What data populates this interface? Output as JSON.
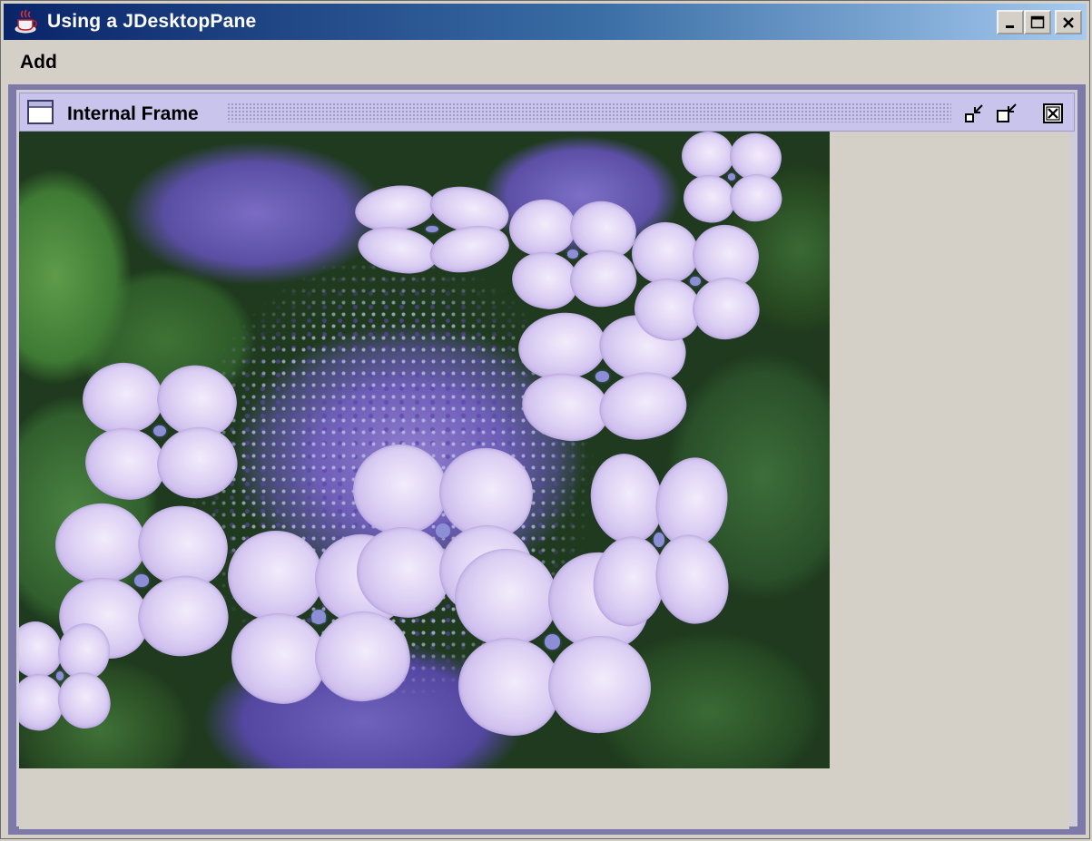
{
  "window": {
    "title": "Using a JDesktopPane",
    "controls": [
      "minimize-icon",
      "maximize-icon",
      "close-icon"
    ]
  },
  "menubar": {
    "items": [
      {
        "label": "Add"
      }
    ]
  },
  "internal_frame": {
    "title": "Internal Frame",
    "controls": [
      "iconify-icon",
      "maximize-icon",
      "close-icon"
    ],
    "content": "hydrangea-photo"
  },
  "colors": {
    "titlebar_start": "#0a246a",
    "titlebar_end": "#a6caf0",
    "internal_frame_border": "#7d79a8",
    "internal_titlebar": "#c8c4ec",
    "background": "#d4d0c8"
  }
}
